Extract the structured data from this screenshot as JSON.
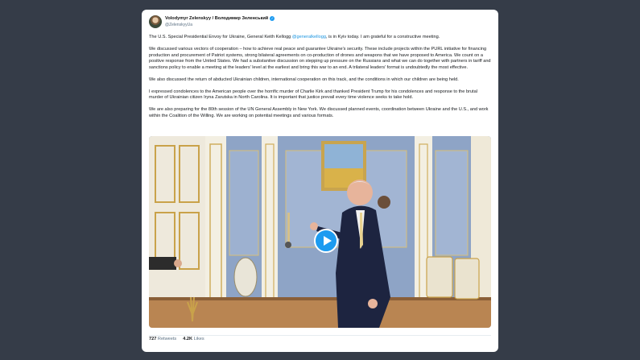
{
  "tweet": {
    "display_name": "Volodymyr Zelenskyy / Володимир Зеленський",
    "handle": "@ZelenskyyUa",
    "paragraphs": [
      {
        "pre": "The U.S. Special Presidential Envoy for Ukraine, General Keith Kellogg ",
        "mention": "@generalkellogg",
        "post": ", is in Kyiv today. I am grateful for a constructive meeting."
      },
      {
        "text": "We discussed various vectors of cooperation – how to achieve real peace and guarantee Ukraine's security. These include projects within the PURL initiative for financing production and procurement of Patriot systems, strong bilateral agreements on co-production of drones and weapons that we have proposed to America. We count on a positive response from the United States. We had a substantive discussion on stepping up pressure on the Russians and what we can do together with partners in tariff and sanctions policy to enable a meeting at the leaders' level at the earliest and bring this war to an end. A trilateral leaders' format is undoubtedly the most effective."
      },
      {
        "text": "We also discussed the return of abducted Ukrainian children, international cooperation on this track, and the conditions in which our children are being held."
      },
      {
        "text": "I expressed condolences to the American people over the horrific murder of Charlie Kirk and thanked President Trump for his condolences and response to the brutal murder of Ukrainian citizen Iryna Zarutska in North Carolina. It is important that justice prevail every time violence seeks to take hold."
      },
      {
        "text": "We are also preparing for the 80th session of the UN General Assembly in New York. We discussed planned events, coordination between Ukraine and the U.S., and work within the Coalition of the Willing. We are working on potential meetings and various formats."
      }
    ],
    "stats": {
      "retweets_count": "727",
      "retweets_label": "Retweets",
      "likes_count": "4.2K",
      "likes_label": "Likes"
    }
  },
  "icons": {
    "verified": "verified-badge-icon",
    "play": "play-icon"
  },
  "colors": {
    "background": "#353c48",
    "card": "#ffffff",
    "mention": "#1b95e0",
    "play_button": "#1d9bf0"
  }
}
